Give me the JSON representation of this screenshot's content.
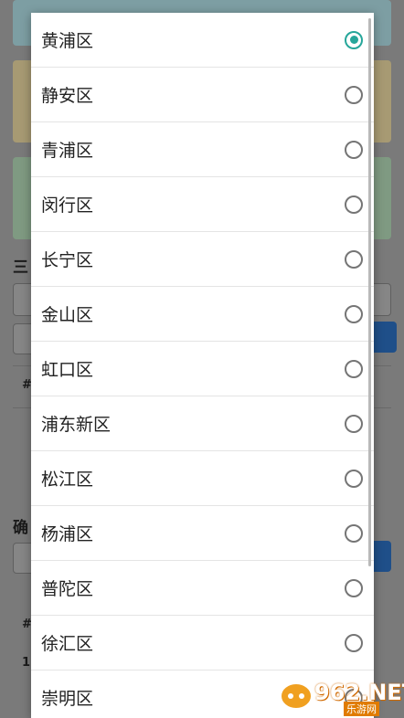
{
  "options": [
    {
      "label": "黄浦区",
      "selected": true
    },
    {
      "label": "静安区",
      "selected": false
    },
    {
      "label": "青浦区",
      "selected": false
    },
    {
      "label": "闵行区",
      "selected": false
    },
    {
      "label": "长宁区",
      "selected": false
    },
    {
      "label": "金山区",
      "selected": false
    },
    {
      "label": "虹口区",
      "selected": false
    },
    {
      "label": "浦东新区",
      "selected": false
    },
    {
      "label": "松江区",
      "selected": false
    },
    {
      "label": "杨浦区",
      "selected": false
    },
    {
      "label": "普陀区",
      "selected": false
    },
    {
      "label": "徐汇区",
      "selected": false
    },
    {
      "label": "崇明区",
      "selected": false
    }
  ],
  "background": {
    "partial_heading_1": "三",
    "partial_heading_2": "确",
    "hash_1": "#",
    "hash_2": "#",
    "row_num": "1"
  },
  "watermark": {
    "logo": "962.NET",
    "sub": "乐游网"
  },
  "colors": {
    "accent": "#26a69a",
    "primary_button": "#1f4f89"
  }
}
